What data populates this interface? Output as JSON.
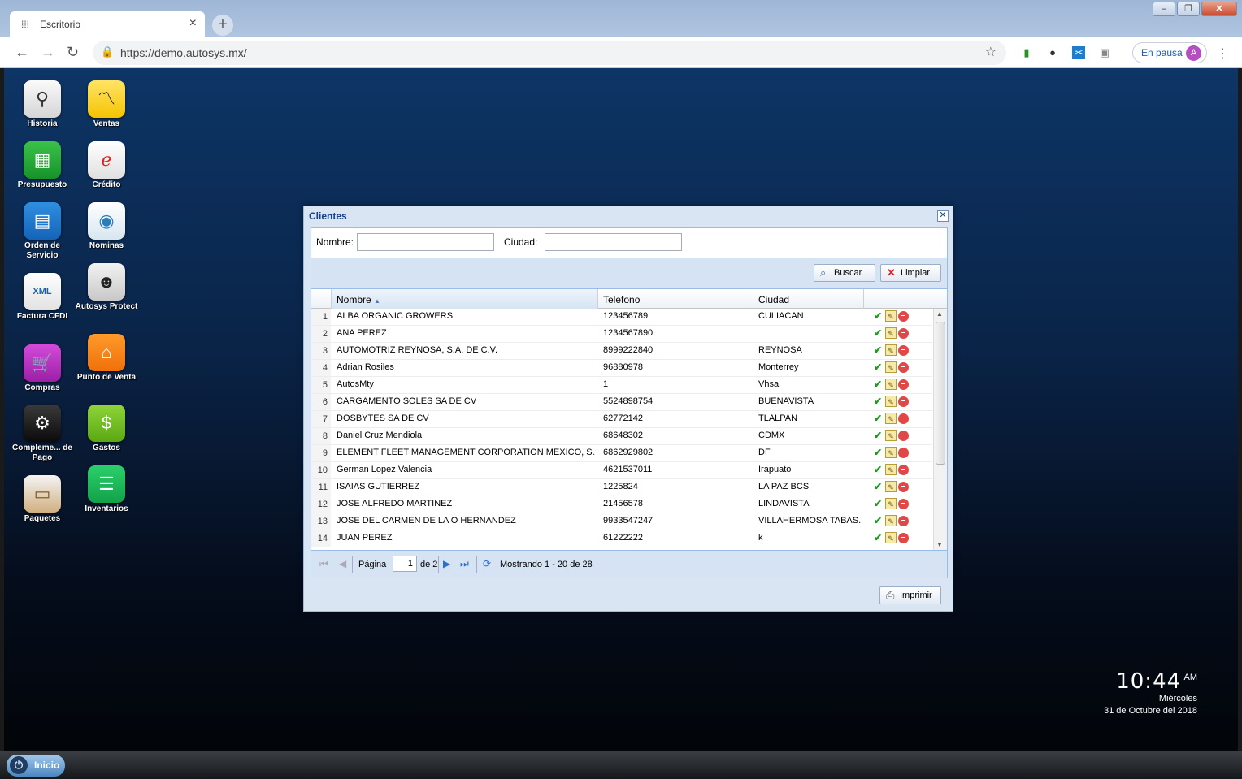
{
  "browser": {
    "tab_title": "Escritorio",
    "url": "https://demo.autosys.mx/",
    "profile_status": "En pausa",
    "profile_initial": "A"
  },
  "desktop": {
    "icons": [
      {
        "label": "Historia",
        "icon": "magnifier-icon"
      },
      {
        "label": "Ventas",
        "icon": "chart-icon"
      },
      {
        "label": "Presupuesto",
        "icon": "spreadsheet-icon"
      },
      {
        "label": "Crédito",
        "icon": "credit-icon"
      },
      {
        "label": "Orden de Servicio",
        "icon": "document-icon"
      },
      {
        "label": "Nominas",
        "icon": "payroll-icon"
      },
      {
        "label": "Factura CFDI",
        "icon": "xml-invoice-icon"
      },
      {
        "label": "Autosys Protect",
        "icon": "protect-icon"
      },
      {
        "label": "Compras",
        "icon": "cart-icon"
      },
      {
        "label": "Punto de Venta",
        "icon": "store-icon"
      },
      {
        "label": "Compleme... de Pago",
        "icon": "payment-complement-icon"
      },
      {
        "label": "Gastos",
        "icon": "coins-icon"
      },
      {
        "label": "Paquetes",
        "icon": "package-icon"
      },
      {
        "label": "Inventarios",
        "icon": "list-icon"
      }
    ],
    "clock": {
      "time": "10:44",
      "ampm": "AM",
      "day": "Miércoles",
      "date": "31 de Octubre del 2018"
    },
    "start_label": "Inicio"
  },
  "dialog": {
    "title": "Clientes",
    "nombre_label": "Nombre:",
    "ciudad_label": "Ciudad:",
    "nombre_value": "",
    "ciudad_value": "",
    "buscar_label": "Buscar",
    "limpiar_label": "Limpiar",
    "imprimir_label": "Imprimir",
    "columns": [
      "Nombre",
      "Telefono",
      "Ciudad"
    ],
    "rows": [
      {
        "n": "1",
        "nombre": "ALBA ORGANIC GROWERS",
        "telefono": "123456789",
        "ciudad": "CULIACAN"
      },
      {
        "n": "2",
        "nombre": "ANA PEREZ",
        "telefono": "1234567890",
        "ciudad": ""
      },
      {
        "n": "3",
        "nombre": "AUTOMOTRIZ REYNOSA, S.A. DE C.V.",
        "telefono": "8999222840",
        "ciudad": "REYNOSA"
      },
      {
        "n": "4",
        "nombre": "Adrian Rosiles",
        "telefono": "96880978",
        "ciudad": "Monterrey"
      },
      {
        "n": "5",
        "nombre": "AutosMty",
        "telefono": "1",
        "ciudad": "Vhsa"
      },
      {
        "n": "6",
        "nombre": "CARGAMENTO SOLES SA DE CV",
        "telefono": "5524898754",
        "ciudad": "BUENAVISTA"
      },
      {
        "n": "7",
        "nombre": "DOSBYTES SA DE CV",
        "telefono": "62772142",
        "ciudad": "TLALPAN"
      },
      {
        "n": "8",
        "nombre": "Daniel Cruz Mendiola",
        "telefono": "68648302",
        "ciudad": "CDMX"
      },
      {
        "n": "9",
        "nombre": "ELEMENT FLEET MANAGEMENT CORPORATION MEXICO, S.A. ...",
        "telefono": "6862929802",
        "ciudad": "DF"
      },
      {
        "n": "10",
        "nombre": "German Lopez Valencia",
        "telefono": "4621537011",
        "ciudad": "Irapuato"
      },
      {
        "n": "11",
        "nombre": "ISAIAS GUTIERREZ",
        "telefono": "1225824",
        "ciudad": "LA PAZ BCS"
      },
      {
        "n": "12",
        "nombre": "JOSE ALFREDO MARTINEZ",
        "telefono": "21456578",
        "ciudad": "LINDAVISTA"
      },
      {
        "n": "13",
        "nombre": "JOSE DEL CARMEN DE LA O HERNANDEZ",
        "telefono": "9933547247",
        "ciudad": "VILLAHERMOSA TABAS..."
      },
      {
        "n": "14",
        "nombre": "JUAN PEREZ",
        "telefono": "61222222",
        "ciudad": "k"
      }
    ],
    "pager": {
      "page_label": "Página",
      "page_value": "1",
      "of_label": "de 2",
      "showing": "Mostrando 1 - 20 de 28"
    }
  }
}
